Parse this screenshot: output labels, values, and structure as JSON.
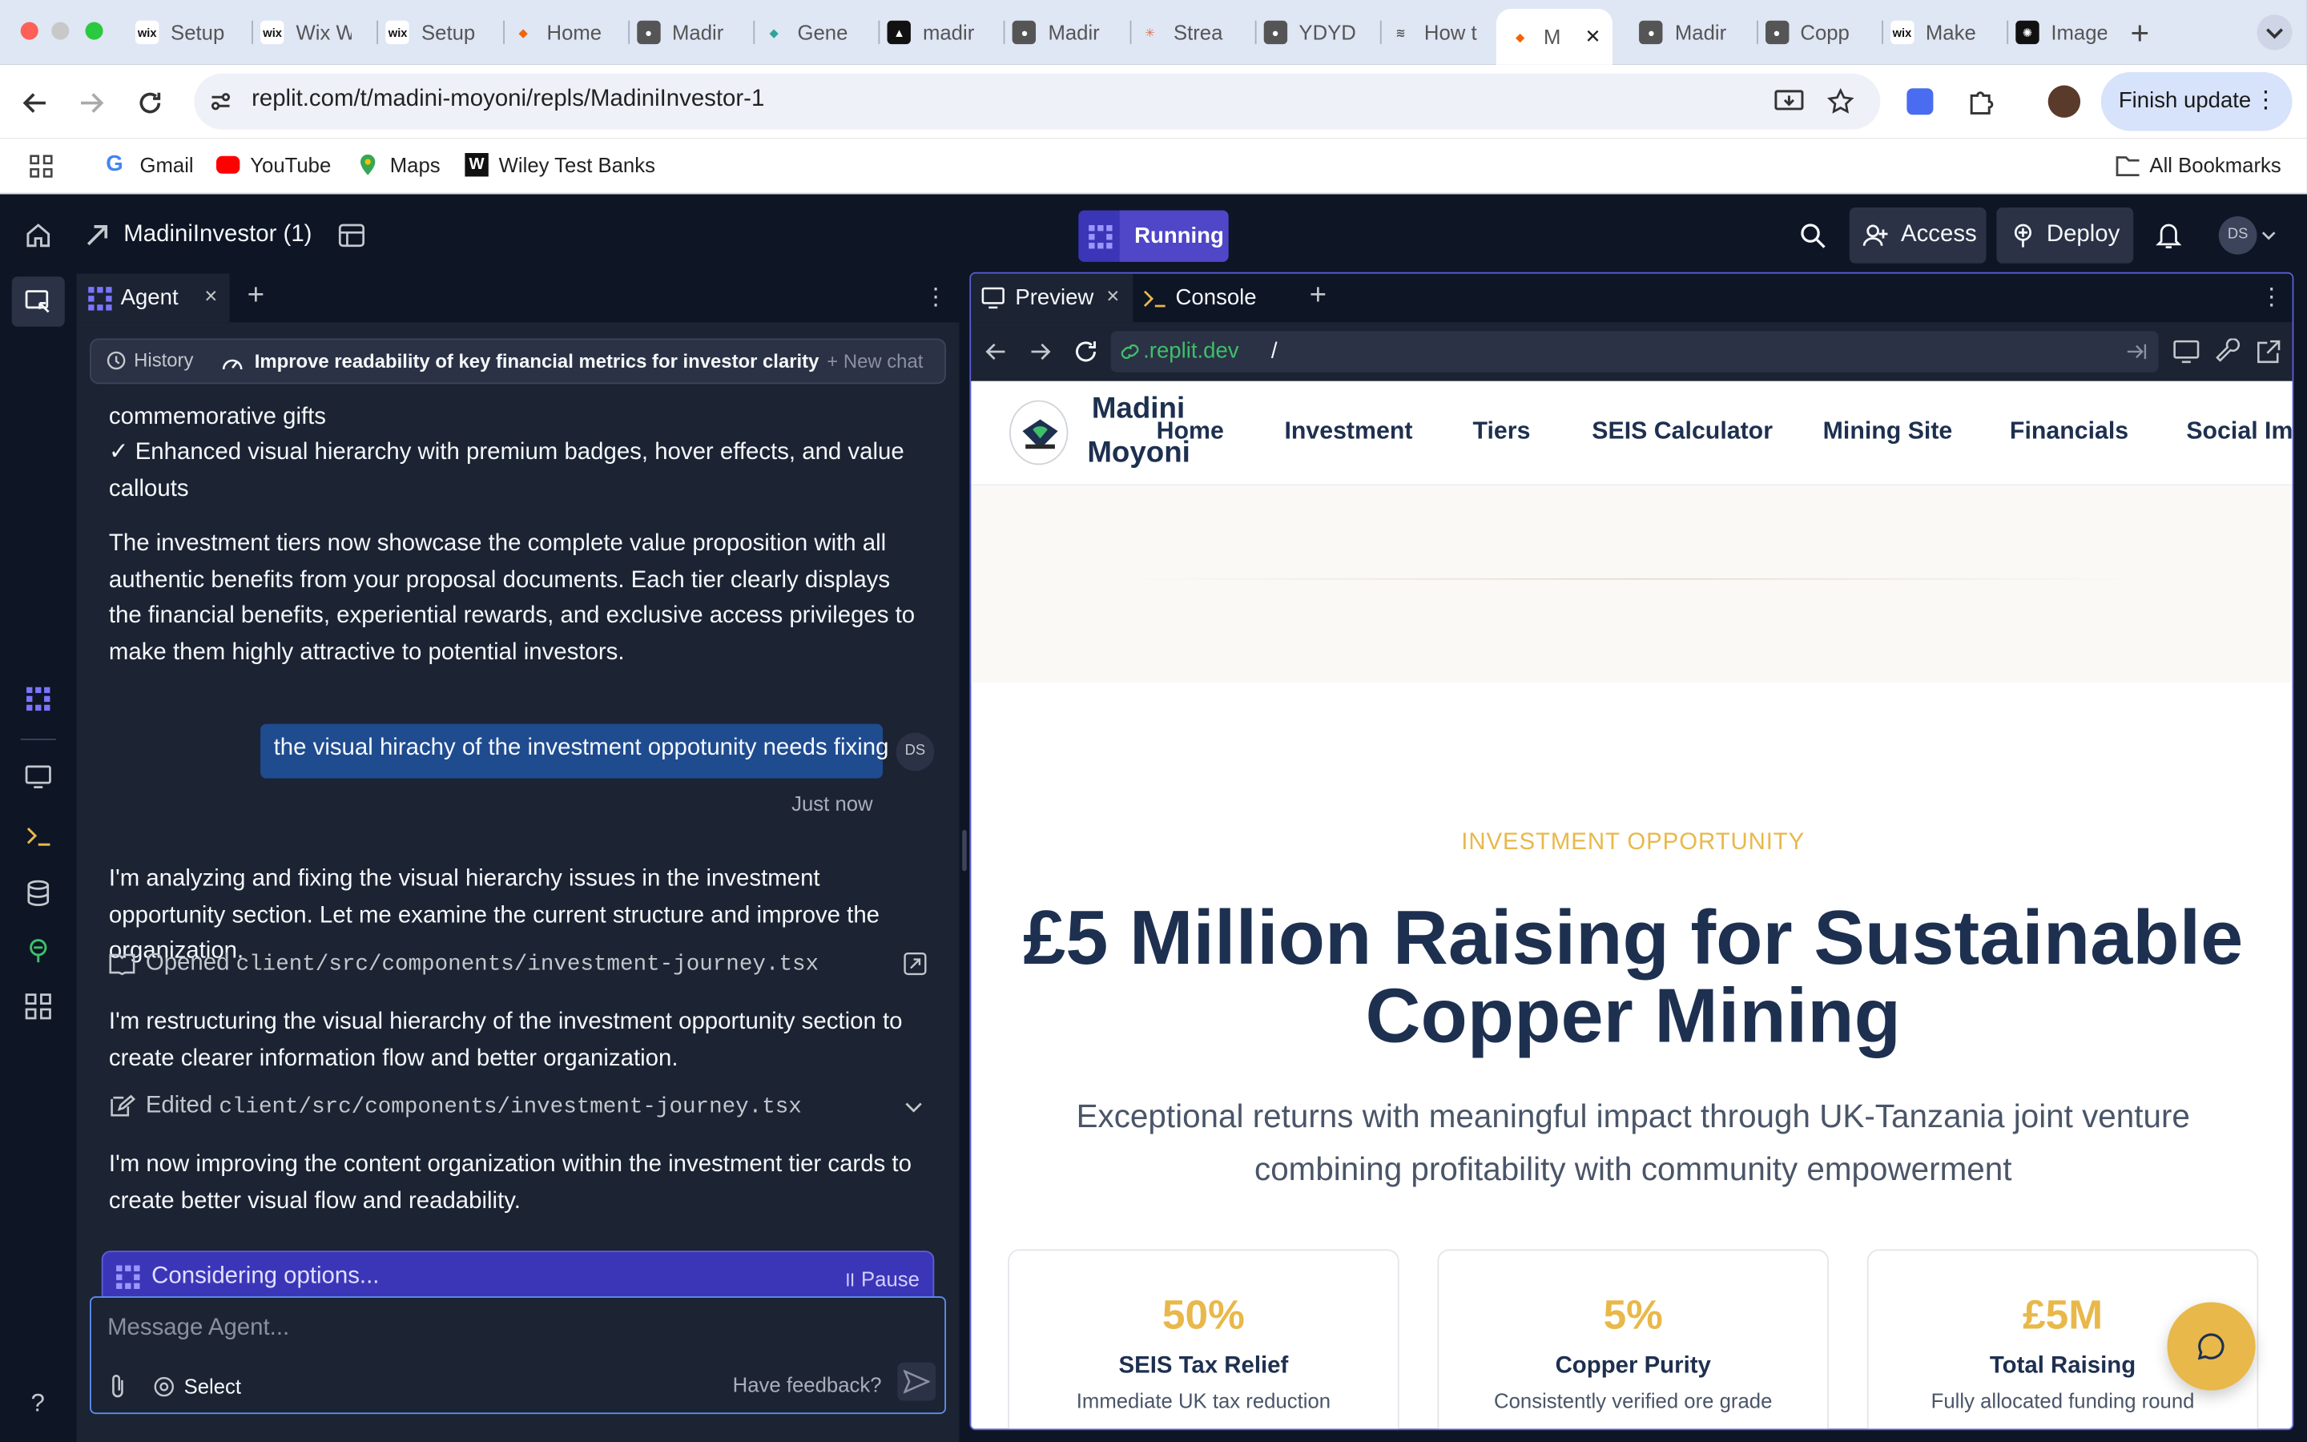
{
  "browser": {
    "tabs": [
      {
        "title": "Setup",
        "icon": "wix-icon"
      },
      {
        "title": "Wix W",
        "icon": "wix-icon"
      },
      {
        "title": "Setup",
        "icon": "wix-icon"
      },
      {
        "title": "Home",
        "icon": "replit-icon"
      },
      {
        "title": "Madir",
        "icon": "globe-icon"
      },
      {
        "title": "Gene",
        "icon": "diamond-icon"
      },
      {
        "title": "madir",
        "icon": "triangle-icon"
      },
      {
        "title": "Madir",
        "icon": "globe-icon"
      },
      {
        "title": "Strea",
        "icon": "claude-icon"
      },
      {
        "title": "YDYD",
        "icon": "globe-icon"
      },
      {
        "title": "How t",
        "icon": "wave-icon"
      },
      {
        "title": "M",
        "icon": "replit-icon"
      },
      {
        "title": "Madir",
        "icon": "globe-icon"
      },
      {
        "title": "Copp",
        "icon": "globe-icon"
      },
      {
        "title": "Make",
        "icon": "wix-icon"
      },
      {
        "title": "Image",
        "icon": "openai-icon"
      }
    ],
    "url": "replit.com/t/madini-moyoni/repls/MadiniInvestor-1",
    "finish_update": "Finish update",
    "bookmarks": [
      "Gmail",
      "YouTube",
      "Maps",
      "Wiley Test Banks"
    ],
    "all_bookmarks": "All Bookmarks"
  },
  "replit": {
    "project_name": "MadiniInvestor (1)",
    "run_status": "Running",
    "access": "Access",
    "deploy": "Deploy",
    "avatar": "DS"
  },
  "agent": {
    "tab_label": "Agent",
    "history": "History",
    "chat_title": "Improve readability of key financial metrics for investor clarity",
    "new_chat": "New chat",
    "messages": {
      "m0": "commemorative gifts",
      "m1": "✓ Enhanced visual hierarchy with premium badges, hover effects, and value callouts",
      "m2": "The investment tiers now showcase the complete value proposition with all authentic benefits from your proposal documents. Each tier clearly displays the financial benefits, experiential rewards, and exclusive access privileges to make them highly attractive to potential investors.",
      "user_msg": "the visual hirachy of the investment oppotunity needs fixing",
      "user_avatar": "DS",
      "user_time": "Just now",
      "m3": "I'm analyzing and fixing the visual hierarchy issues in the investment opportunity section. Let me examine the current structure and improve the organization.",
      "opened_label": "Opened",
      "opened_file": "client/src/components/investment-journey.tsx",
      "m4": "I'm restructuring the visual hierarchy of the investment opportunity section to create clearer information flow and better organization.",
      "edited_label": "Edited",
      "edited_file": "client/src/components/investment-journey.tsx",
      "m5": "I'm now improving the content organization within the investment tier cards to create better visual flow and readability."
    },
    "status": "Considering options...",
    "pause": "Pause",
    "input_placeholder": "Message Agent...",
    "select": "Select",
    "feedback": "Have feedback?"
  },
  "preview": {
    "tab_preview": "Preview",
    "tab_console": "Console",
    "url_host": ".replit.dev",
    "url_path": "/",
    "site": {
      "logo_line1": "Madini",
      "logo_line2": "Moyoni",
      "nav": [
        "Home",
        "Investment",
        "Tiers",
        "SEIS Calculator",
        "Mining Site",
        "Financials",
        "Social Imp"
      ],
      "eyebrow": "INVESTMENT OPPORTUNITY",
      "headline_line1": "£5 Million Raising for Sustainable",
      "headline_line2": "Copper Mining",
      "subhead_line1": "Exceptional returns with meaningful impact through UK-Tanzania joint venture",
      "subhead_line2": "combining profitability with community empowerment",
      "stats": [
        {
          "value": "50%",
          "label": "SEIS Tax Relief",
          "sub": "Immediate UK tax reduction"
        },
        {
          "value": "5%",
          "label": "Copper Purity",
          "sub": "Consistently verified ore grade"
        },
        {
          "value": "£5M",
          "label": "Total Raising",
          "sub": "Fully allocated funding round"
        }
      ]
    }
  },
  "colors": {
    "accent": "#5b5fd6",
    "gold": "#e8b84a",
    "navy": "#1e3050",
    "running": "#4f46c8"
  }
}
